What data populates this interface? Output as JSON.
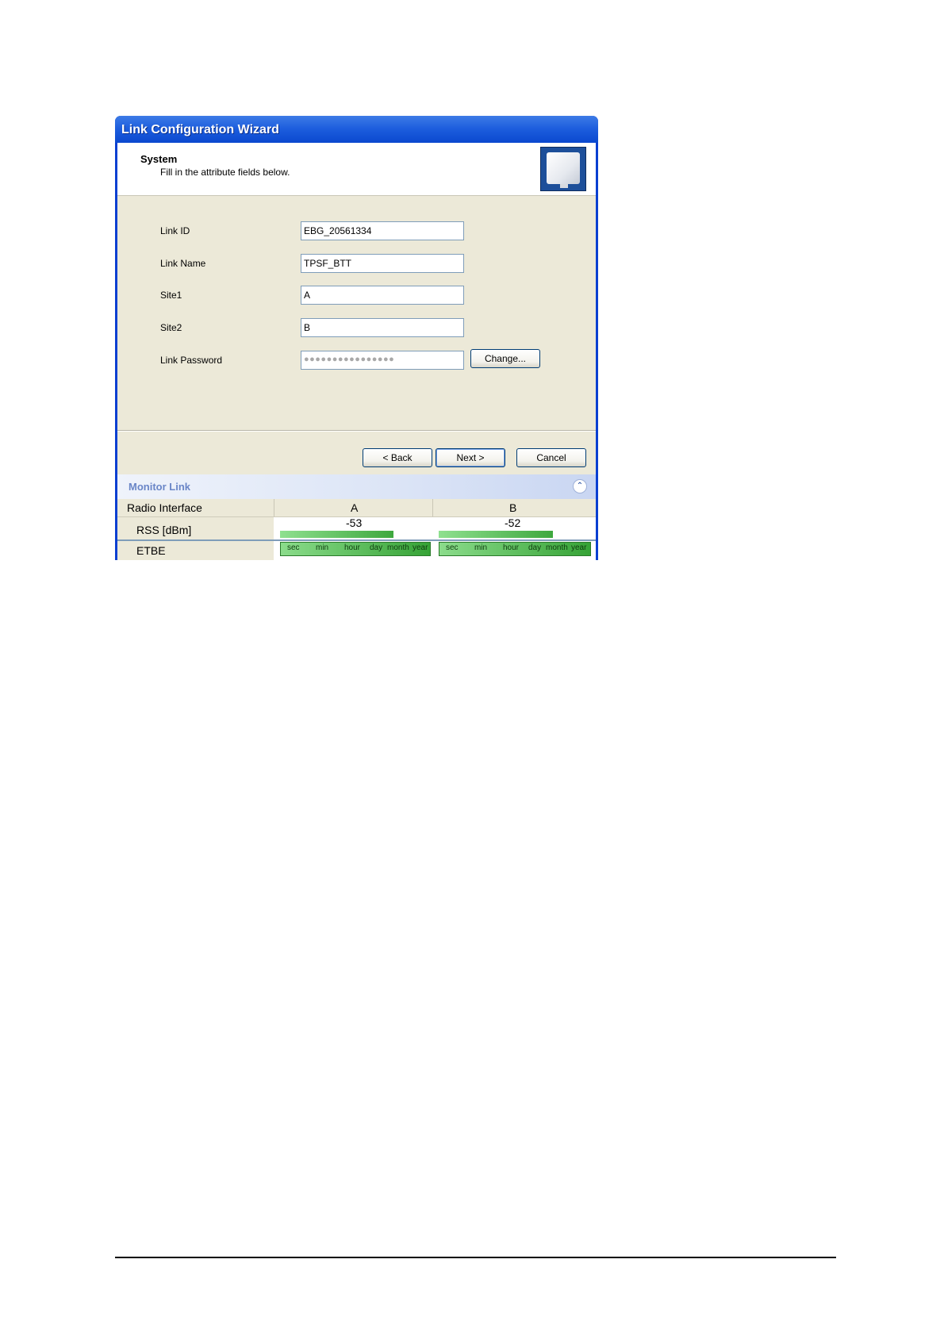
{
  "window": {
    "title": "Link Configuration Wizard"
  },
  "header": {
    "title": "System",
    "subtitle": "Fill in the attribute fields below."
  },
  "fields": [
    {
      "label": "Link ID",
      "value": "EBG_20561334"
    },
    {
      "label": "Link Name",
      "value": "TPSF_BTT"
    },
    {
      "label": "Site1",
      "value": "A"
    },
    {
      "label": "Site2",
      "value": "B"
    },
    {
      "label": "Link Password",
      "value": "●●●●●●●●●●●●●●●●"
    }
  ],
  "buttons": {
    "change": "Change...",
    "back": "< Back",
    "next": "Next >",
    "cancel": "Cancel"
  },
  "monitor": {
    "title": "Monitor Link",
    "columns": [
      "Radio Interface",
      "A",
      "B"
    ],
    "rss": {
      "label": "RSS [dBm]",
      "a": "-53",
      "b": "-52",
      "a_fill": 0.75,
      "b_fill": 0.76
    },
    "etbe": {
      "label": "ETBE",
      "scale": [
        "sec",
        "min",
        "hour",
        "day",
        "month",
        "year"
      ]
    }
  },
  "colors": {
    "title_bar": "#0a48cf",
    "window_bg": "#ece9d8",
    "bar_green": "#3ea83e",
    "monitor_title": "#6a86c7"
  }
}
